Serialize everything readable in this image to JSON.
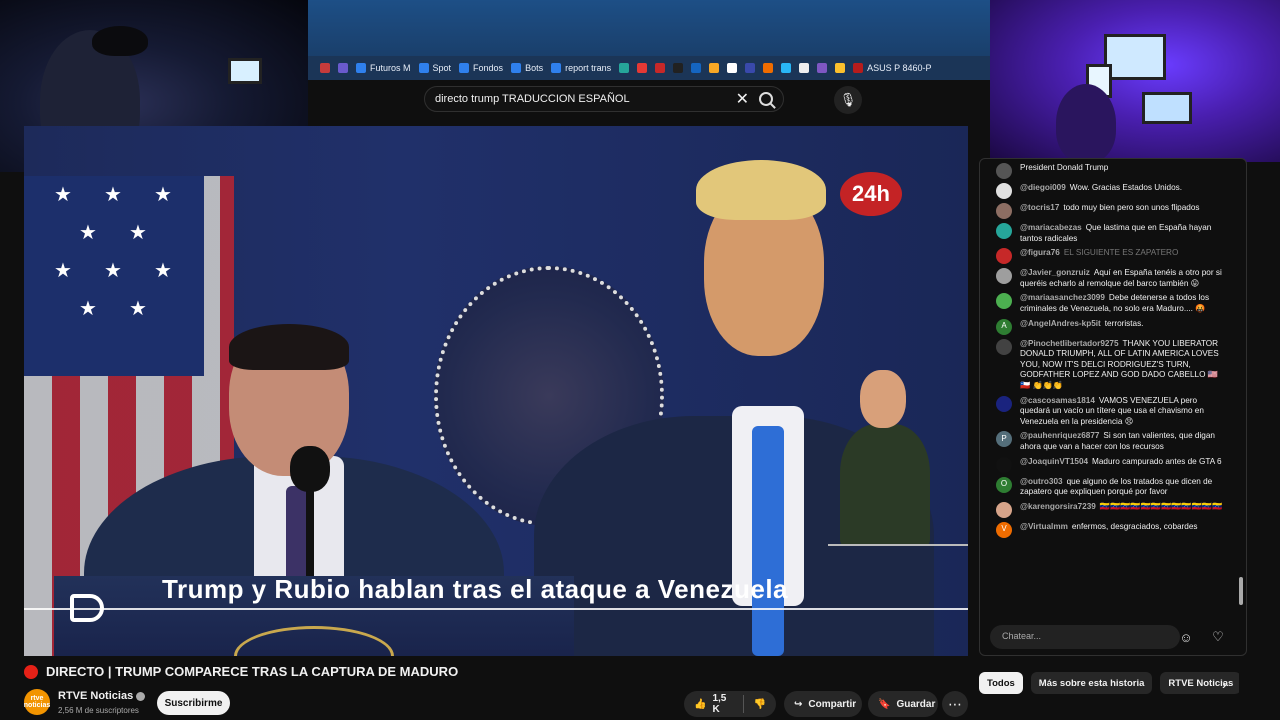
{
  "bookmarks": [
    {
      "label": "",
      "color": "#c63b3b"
    },
    {
      "label": "",
      "color": "#6a5acd"
    },
    {
      "label": "Futuros M",
      "color": "#2f80ed"
    },
    {
      "label": "Spot",
      "color": "#2f80ed"
    },
    {
      "label": "Fondos",
      "color": "#2f80ed"
    },
    {
      "label": "Bots",
      "color": "#2f80ed"
    },
    {
      "label": "report trans",
      "color": "#2f80ed"
    },
    {
      "label": "",
      "color": "#26a69a"
    },
    {
      "label": "",
      "color": "#e53935"
    },
    {
      "label": "",
      "color": "#c62828"
    },
    {
      "label": "",
      "color": "#212121"
    },
    {
      "label": "",
      "color": "#1565c0"
    },
    {
      "label": "",
      "color": "#f9a825"
    },
    {
      "label": "",
      "color": "#ffffff"
    },
    {
      "label": "",
      "color": "#3949ab"
    },
    {
      "label": "",
      "color": "#ef6c00"
    },
    {
      "label": "",
      "color": "#29b6f6"
    },
    {
      "label": "",
      "color": "#eeeeee"
    },
    {
      "label": "",
      "color": "#7e57c2"
    },
    {
      "label": "",
      "color": "#fbc02d"
    },
    {
      "label": "ASUS P 8460-P",
      "color": "#b71c1c"
    }
  ],
  "search": {
    "value": "directo trump TRADUCCION ESPAÑOL",
    "clear_icon": "close-icon",
    "search_icon": "search-icon",
    "mic_icon": "microphone-icon"
  },
  "video": {
    "caption": "Trump y Rubio hablan tras el ataque a Venezuela",
    "logo": "24h"
  },
  "title": "DIRECTO | TRUMP COMPARECE TRAS LA CAPTURA DE MADURO",
  "channel": {
    "name": "RTVE Noticias",
    "avatar_text": "rtve noticias",
    "subscribers": "2,56 M de suscriptores",
    "subscribe_label": "Suscribirme"
  },
  "actions": {
    "likes": "1,5 K",
    "share_label": "Compartir",
    "save_label": "Guardar"
  },
  "chat": {
    "messages": [
      {
        "author": "",
        "text": "President Donald Trump",
        "avatar_color": "#555"
      },
      {
        "author": "@diegoi009",
        "text": "Wow. Gracias Estados Unidos.",
        "avatar_color": "#e0e0e0"
      },
      {
        "author": "@tocris17",
        "text": "todo muy bien pero son unos flipados",
        "avatar_color": "#8d6e63"
      },
      {
        "author": "@mariacabezas",
        "text": "Que lastima que en España hayan tantos radicales",
        "avatar_color": "#26a69a"
      },
      {
        "author": "@figura76",
        "text": "EL SIGUIENTE ES ZAPATERO",
        "avatar_color": "#c62828",
        "faded": true
      },
      {
        "author": "@Javier_gonzruiz",
        "text": "Aquí en España tenéis a otro por si queréis echarlo al remolque del barco también 😛",
        "avatar_color": "#9e9e9e"
      },
      {
        "author": "@mariaasanchez3099",
        "text": "Debe detenerse a todos los criminales de Venezuela, no solo era Maduro.... 🤬",
        "avatar_color": "#4caf50"
      },
      {
        "author": "@AngelAndres-kp5it",
        "text": "terroristas.",
        "avatar_color": "#2e7d32",
        "initial": "A"
      },
      {
        "author": "@Pinochetlibertador9275",
        "text": "THANK YOU LIBERATOR DONALD TRIUMPH, ALL OF LATIN AMERICA LOVES YOU, NOW IT'S DELCI RODRIGUEZ'S TURN, GODFATHER LOPEZ AND GOD DADO CABELLO 🇺🇸🇨🇱 👏👏👏",
        "avatar_color": "#424242"
      },
      {
        "author": "@cascosamas1814",
        "text": "VAMOS VENEZUELA pero quedará un vacío un títere que usa el chavismo en Venezuela en la presidencia 😣",
        "avatar_color": "#1a237e"
      },
      {
        "author": "@pauhenriquez6877",
        "text": "Si son tan valientes, que digan ahora que van a hacer con los recursos",
        "avatar_color": "#546e7a",
        "initial": "P"
      },
      {
        "author": "@JoaquinVT1504",
        "text": "Maduro campurado antes de GTA 6",
        "avatar_color": "#111111"
      },
      {
        "author": "@outro303",
        "text": "que alguno de los tratados que dicen de zapatero que expliquen porqué por favor",
        "avatar_color": "#2e7d32",
        "initial": "O"
      },
      {
        "author": "@karengorsira7239",
        "text": "🇻🇪🇻🇪🇻🇪🇻🇪🇻🇪🇻🇪🇻🇪🇻🇪🇻🇪🇻🇪🇻🇪🇻🇪",
        "avatar_color": "#d7a48a"
      },
      {
        "author": "@Virtualmm",
        "text": "enfermos, desgraciados, cobardes",
        "avatar_color": "#ef6c00",
        "initial": "V"
      }
    ],
    "input_placeholder": "Chatear...",
    "emoji_icon": "emoji-icon",
    "heart_icon": "heart-icon"
  },
  "chips": [
    {
      "label": "Todos",
      "active": true
    },
    {
      "label": "Más sobre esta historia",
      "active": false
    },
    {
      "label": "RTVE Noticias",
      "active": false
    }
  ]
}
